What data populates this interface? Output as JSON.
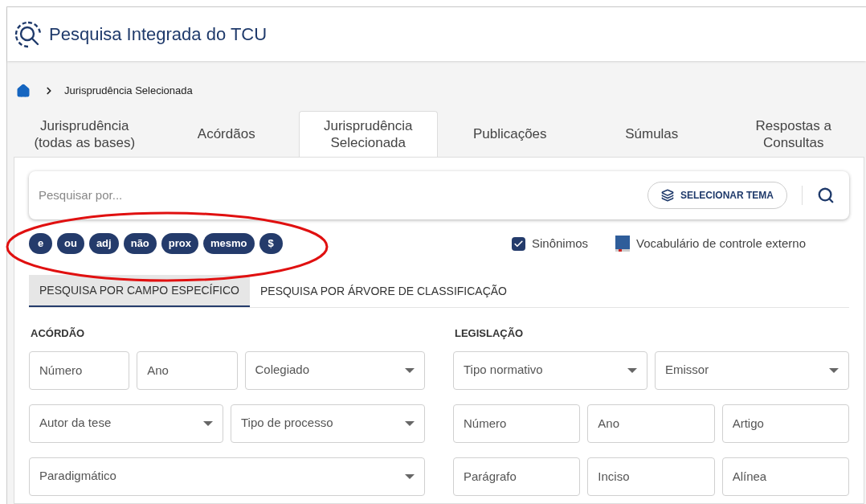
{
  "header": {
    "title": "Pesquisa Integrada do TCU"
  },
  "breadcrumb": {
    "current": "Jurisprudência Selecionada"
  },
  "tabs": [
    {
      "label": "Jurisprudência\n(todas as bases)",
      "selected": false
    },
    {
      "label": "Acórdãos",
      "selected": false
    },
    {
      "label": "Jurisprudência\nSelecionada",
      "selected": true
    },
    {
      "label": "Publicações",
      "selected": false
    },
    {
      "label": "Súmulas",
      "selected": false
    },
    {
      "label": "Respostas a\nConsultas",
      "selected": false
    }
  ],
  "search": {
    "placeholder": "Pesquisar por...",
    "theme_button": "SELECIONAR TEMA"
  },
  "operators": [
    "e",
    "ou",
    "adj",
    "não",
    "prox",
    "mesmo",
    "$"
  ],
  "options": {
    "synonyms": {
      "label": "Sinônimos",
      "checked": true
    },
    "vocabulary": {
      "label": "Vocabulário de controle externo"
    }
  },
  "subtabs": [
    {
      "label": "PESQUISA POR CAMPO ESPECÍFICO",
      "selected": true
    },
    {
      "label": "PESQUISA POR ÁRVORE DE CLASSIFICAÇÃO",
      "selected": false
    }
  ],
  "sections": [
    {
      "title": "ACÓRDÃO",
      "field_groups": [
        {
          "fields": [
            {
              "kind": "text",
              "placeholder": "Número"
            },
            {
              "kind": "text",
              "placeholder": "Ano"
            },
            {
              "kind": "select",
              "placeholder": "Colegiado"
            }
          ]
        },
        {
          "fields": [
            {
              "kind": "select",
              "placeholder": "Autor da tese"
            },
            {
              "kind": "select",
              "placeholder": "Tipo de processo"
            }
          ]
        },
        {
          "fields": [
            {
              "kind": "select",
              "placeholder": "Paradigmático"
            }
          ]
        }
      ]
    },
    {
      "title": "LEGISLAÇÃO",
      "field_groups": [
        {
          "fields": [
            {
              "kind": "select",
              "placeholder": "Tipo normativo"
            },
            {
              "kind": "select",
              "placeholder": "Emissor"
            }
          ]
        },
        {
          "fields": [
            {
              "kind": "text",
              "placeholder": "Número"
            },
            {
              "kind": "text",
              "placeholder": "Ano"
            },
            {
              "kind": "text",
              "placeholder": "Artigo"
            }
          ]
        },
        {
          "fields": [
            {
              "kind": "text",
              "placeholder": "Parágrafo"
            },
            {
              "kind": "text",
              "placeholder": "Inciso"
            },
            {
              "kind": "text",
              "placeholder": "Alínea"
            }
          ]
        }
      ]
    }
  ]
}
